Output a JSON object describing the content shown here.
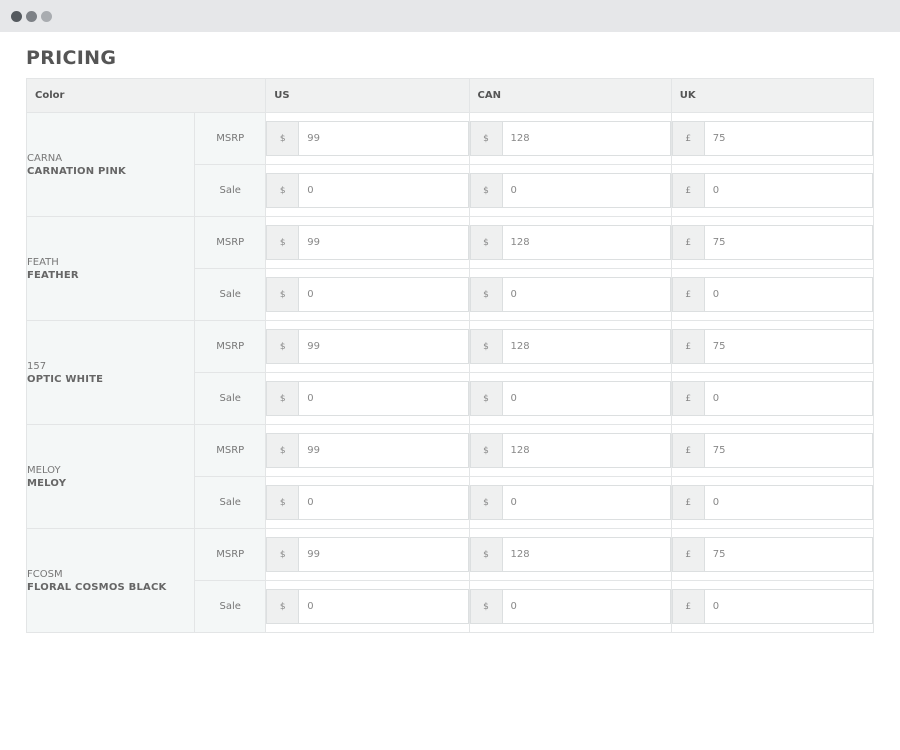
{
  "page": {
    "title": "PRICING"
  },
  "table": {
    "headers": {
      "color": "Color",
      "us": "US",
      "can": "CAN",
      "uk": "UK"
    },
    "currency_symbols": {
      "us": "$",
      "can": "$",
      "uk": "£"
    },
    "row_types": {
      "msrp": "MSRP",
      "sale": "Sale"
    },
    "colors": [
      {
        "code": "CARNA",
        "name": "CARNATION PINK",
        "msrp": {
          "us": "99",
          "can": "128",
          "uk": "75"
        },
        "sale": {
          "us": "0",
          "can": "0",
          "uk": "0"
        }
      },
      {
        "code": "FEATH",
        "name": "FEATHER",
        "msrp": {
          "us": "99",
          "can": "128",
          "uk": "75"
        },
        "sale": {
          "us": "0",
          "can": "0",
          "uk": "0"
        }
      },
      {
        "code": "157",
        "name": "OPTIC WHITE",
        "msrp": {
          "us": "99",
          "can": "128",
          "uk": "75"
        },
        "sale": {
          "us": "0",
          "can": "0",
          "uk": "0"
        }
      },
      {
        "code": "MELOY",
        "name": "MELOY",
        "msrp": {
          "us": "99",
          "can": "128",
          "uk": "75"
        },
        "sale": {
          "us": "0",
          "can": "0",
          "uk": "0"
        }
      },
      {
        "code": "FCOSM",
        "name": "FLORAL COSMOS BLACK",
        "msrp": {
          "us": "99",
          "can": "128",
          "uk": "75"
        },
        "sale": {
          "us": "0",
          "can": "0",
          "uk": "0"
        }
      }
    ]
  }
}
